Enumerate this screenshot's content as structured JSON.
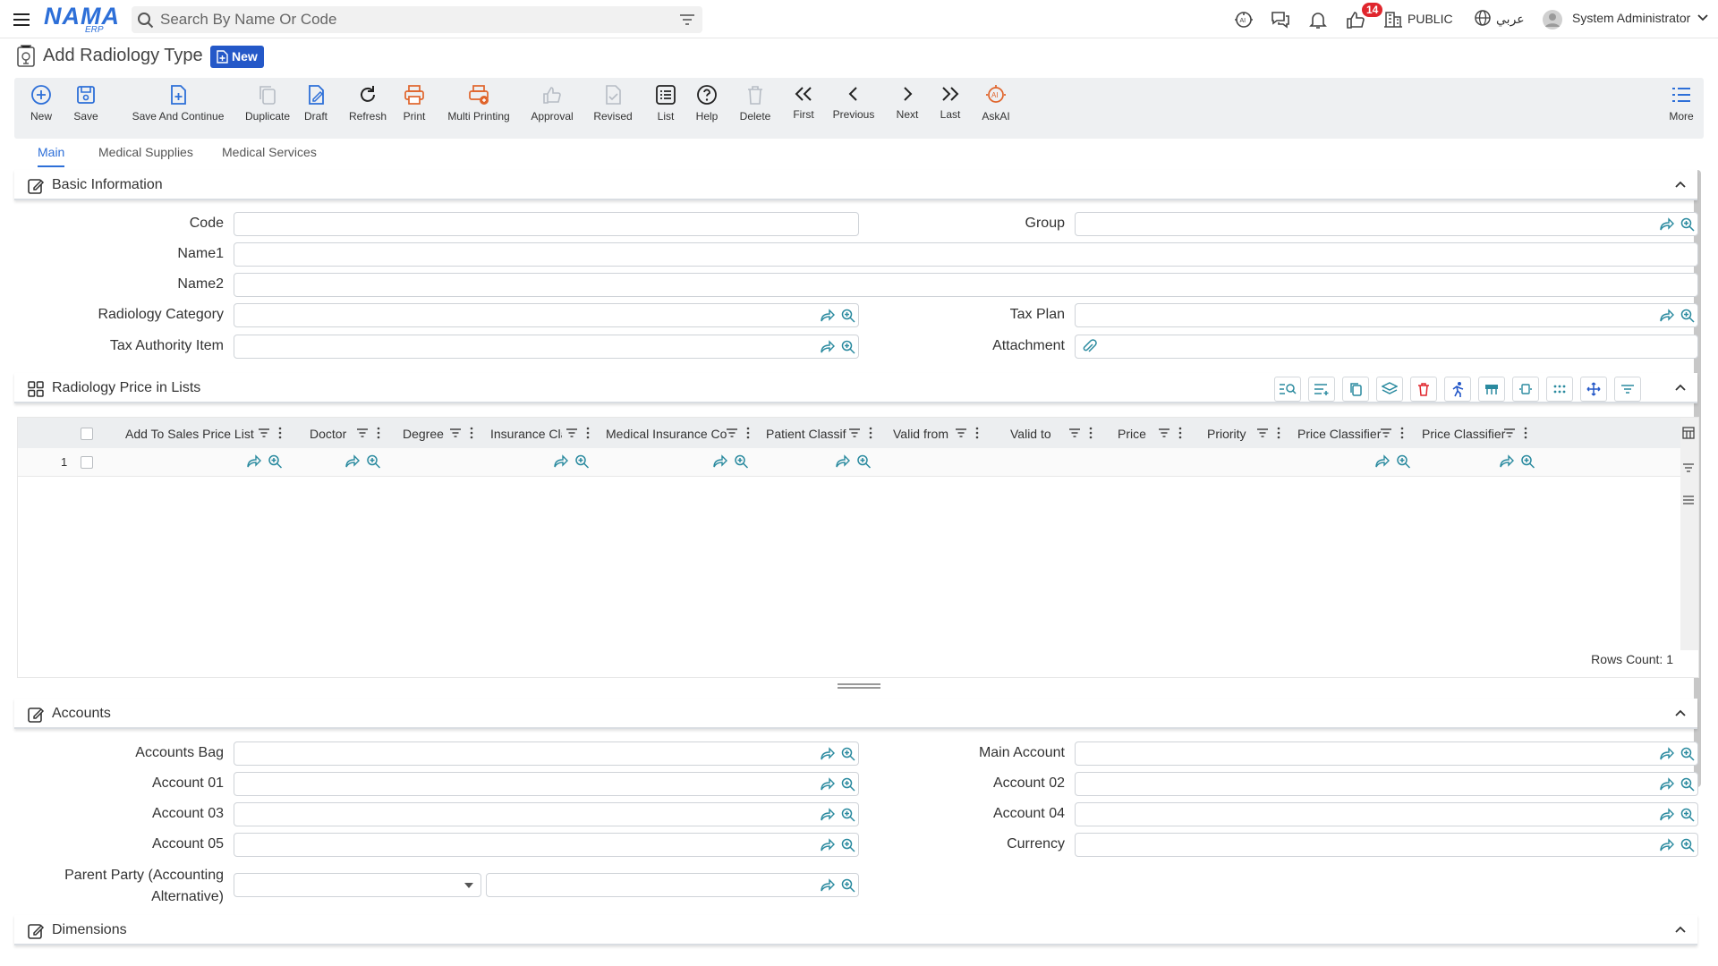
{
  "app": {
    "logo_main": "NAMA",
    "logo_sub": "ERP",
    "search_placeholder": "Search By Name Or Code",
    "notifications_count": "14",
    "domain_label": "PUBLIC",
    "language_label": "عربي",
    "user_name": "System Administrator"
  },
  "page": {
    "title": "Add Radiology Type",
    "status_badge": "New"
  },
  "toolbar": {
    "new": "New",
    "save": "Save",
    "save_continue": "Save And Continue",
    "duplicate": "Duplicate",
    "draft": "Draft",
    "refresh": "Refresh",
    "print": "Print",
    "multi_printing": "Multi Printing",
    "approval": "Approval",
    "revised": "Revised",
    "list": "List",
    "help": "Help",
    "delete": "Delete",
    "first": "First",
    "previous": "Previous",
    "next": "Next",
    "last": "Last",
    "askai": "AskAI",
    "more": "More"
  },
  "tabs": {
    "main": "Main",
    "medical_supplies": "Medical Supplies",
    "medical_services": "Medical Services"
  },
  "basic": {
    "title": "Basic Information",
    "code": "Code",
    "group": "Group",
    "name1": "Name1",
    "name2": "Name2",
    "radiology_category": "Radiology Category",
    "tax_plan": "Tax Plan",
    "tax_authority_item": "Tax Authority Item",
    "attachment": "Attachment"
  },
  "prices": {
    "title": "Radiology Price in Lists",
    "columns": {
      "c1": "Add To Sales Price List",
      "c2": "Doctor",
      "c3": "Degree",
      "c4": "Insurance Cla",
      "c5": "Medical Insurance Co",
      "c6": "Patient Classif",
      "c7": "Valid from",
      "c8": "Valid to",
      "c9": "Price",
      "c10": "Priority",
      "c11": "Price Classifier",
      "c12": "Price Classifier"
    },
    "row_number": "1",
    "rows_count": "Rows Count: 1"
  },
  "accounts": {
    "title": "Accounts",
    "accounts_bag": "Accounts Bag",
    "main_account": "Main Account",
    "account01": "Account 01",
    "account02": "Account 02",
    "account03": "Account 03",
    "account04": "Account 04",
    "account05": "Account 05",
    "currency": "Currency",
    "parent_party_line1": "Parent Party (Accounting",
    "parent_party_line2": "Alternative)"
  },
  "dimensions": {
    "title": "Dimensions"
  },
  "colors": {
    "accent": "#2d6fd8",
    "badge_bg": "#2458c8",
    "print_orange": "#e0642b",
    "teal": "#2a8a9f",
    "danger": "#e0262d"
  }
}
